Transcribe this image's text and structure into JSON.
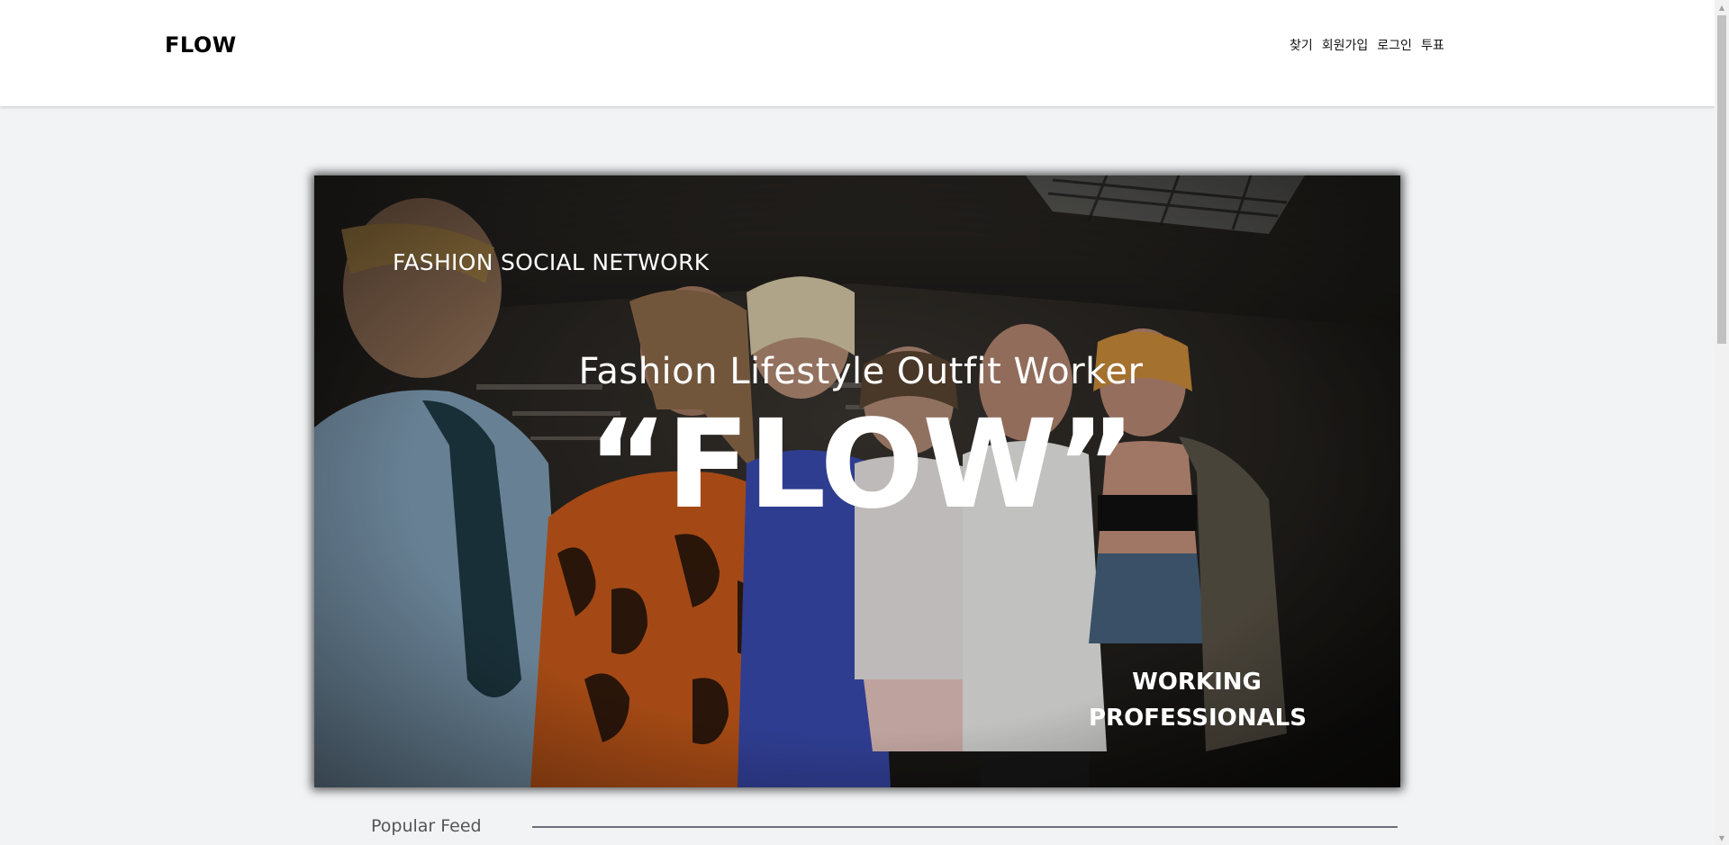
{
  "header": {
    "logo": "FLOW",
    "nav": [
      {
        "label": "찾기"
      },
      {
        "label": "회원가입"
      },
      {
        "label": "로그인"
      },
      {
        "label": "투표"
      }
    ]
  },
  "hero": {
    "subtitle": "FASHION SOCIAL NETWORK",
    "tagline": "Fashion Lifestyle Outfit Worker",
    "title": "“FLOW”",
    "badge_line1": "WORKING",
    "badge_line2": "PROFESSIONALS"
  },
  "feed": {
    "section_title": "Popular Feed"
  },
  "colors": {
    "background": "#f2f3f5",
    "header_bg": "#ffffff",
    "text": "#111111",
    "divider": "#6b6e76"
  }
}
